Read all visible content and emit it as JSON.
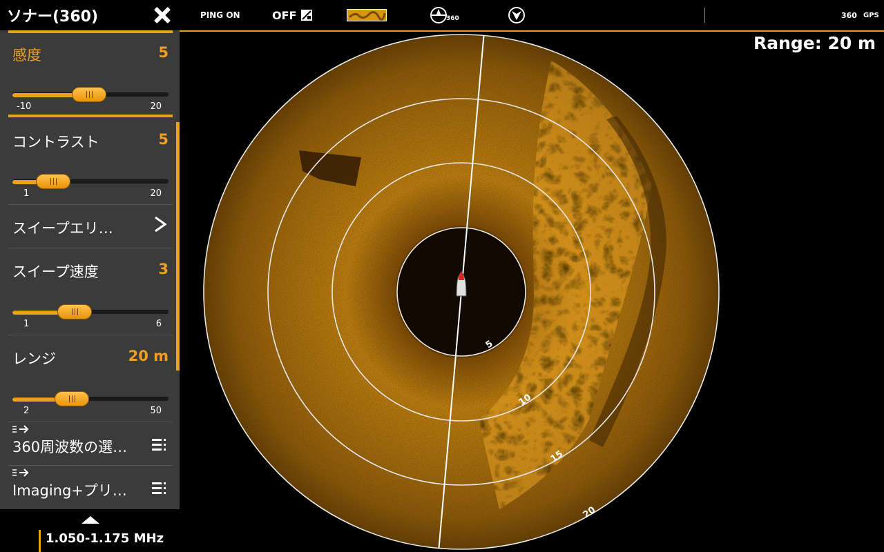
{
  "menu": {
    "title": "ソナー(360)",
    "items": [
      {
        "label": "感度",
        "value": "5",
        "slider": {
          "min": "-10",
          "max": "20",
          "fraction": 0.49
        }
      },
      {
        "label": "コントラスト",
        "value": "5",
        "slider": {
          "min": "1",
          "max": "20",
          "fraction": 0.26
        }
      },
      {
        "label": "スイープエリ…"
      },
      {
        "label": "スイープ速度",
        "value": "3",
        "slider": {
          "min": "1",
          "max": "6",
          "fraction": 0.4
        }
      },
      {
        "label": "レンジ",
        "value": "20 m",
        "slider": {
          "min": "2",
          "max": "50",
          "fraction": 0.38
        }
      },
      {
        "label": "360周波数の選…"
      },
      {
        "label": "Imaging+プリ…"
      }
    ]
  },
  "topbar": {
    "ping": "PING ON",
    "off": "OFF",
    "mode_badge": "360",
    "status_badge_360": "360",
    "status_badge_gps": "GPS"
  },
  "status": {
    "frequency": "1.050-1.175 MHz",
    "range": "Range: 20 m"
  },
  "sonar": {
    "ring_labels": [
      "5",
      "10",
      "15",
      "20"
    ],
    "heading_deg": 5,
    "colors": {
      "accent": "#e8a21c",
      "echo": "#c98510",
      "ring": "#e8e8e8"
    }
  },
  "icons": [
    "close-icon",
    "palette-icon",
    "sonar-orientation-icon",
    "north-up-icon",
    "chevron-right-icon",
    "list-menu-icon",
    "submenu-arrow-icon",
    "chevron-up-icon",
    "boat-icon"
  ]
}
